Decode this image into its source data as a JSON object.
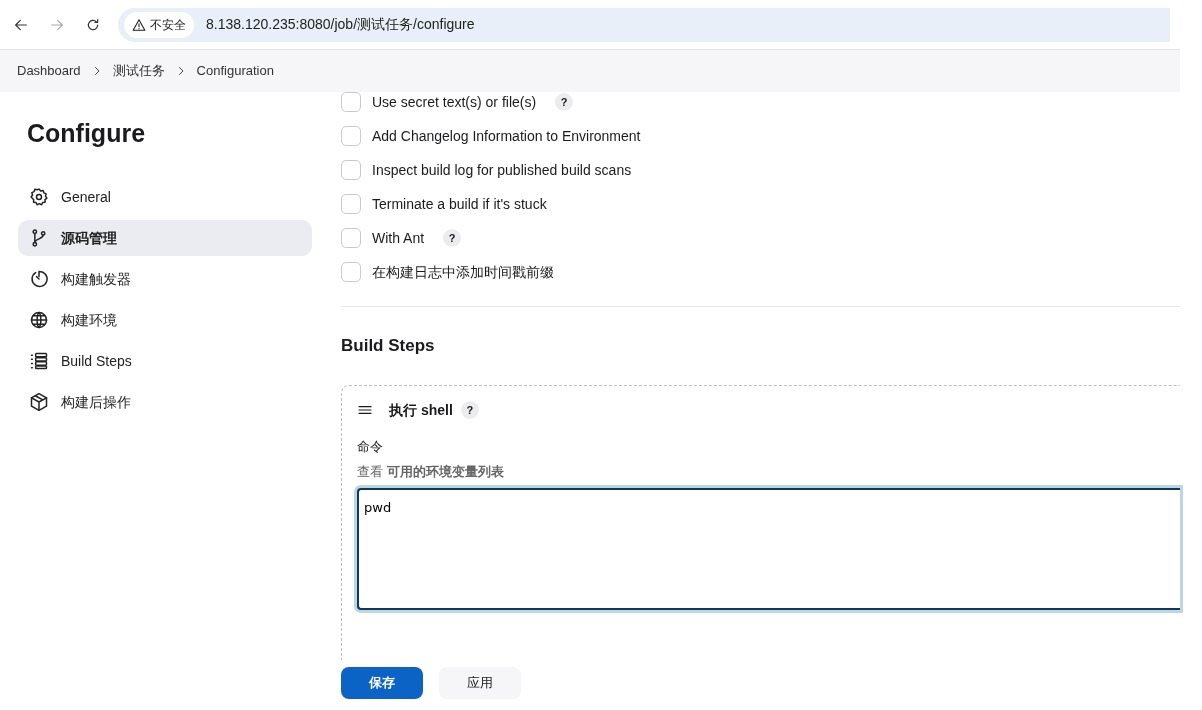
{
  "browser": {
    "nav": [
      {
        "kind": "back",
        "disabled": false
      },
      {
        "kind": "forward",
        "disabled": true
      },
      {
        "kind": "reload",
        "disabled": false
      }
    ],
    "security": "不安全",
    "url": "8.138.120.235:8080/job/测试任务/configure"
  },
  "breadcrumbs": [
    "Dashboard",
    "测试任务",
    "Configuration"
  ],
  "sidebar": {
    "title": "Configure",
    "items": [
      {
        "label": "General",
        "selected": false
      },
      {
        "label": "源码管理",
        "selected": true
      },
      {
        "label": "构建触发器",
        "selected": false
      },
      {
        "label": "构建环境",
        "selected": false
      },
      {
        "label": "Build Steps",
        "selected": false
      },
      {
        "label": "构建后操作",
        "selected": false
      }
    ]
  },
  "options": [
    {
      "label": "Use secret text(s) or file(s)",
      "checked": false,
      "help": "?"
    },
    {
      "label": "Add Changelog Information to Environment",
      "checked": false
    },
    {
      "label": "Inspect build log for published build scans",
      "checked": false
    },
    {
      "label": "Terminate a build if it's stuck",
      "checked": false
    },
    {
      "label": "With Ant",
      "checked": false,
      "help": "?"
    },
    {
      "label": "在构建日志中添加时间戳前缀",
      "checked": false
    }
  ],
  "build_steps": {
    "title": "Build Steps",
    "step": {
      "title": "执行 shell",
      "help": "?",
      "field_label": "命令",
      "hint_prefix": "查看",
      "hint_link": "可用的环境变量列表",
      "value": "pwd"
    }
  },
  "buttons": [
    {
      "label": "保存",
      "kind": "primary"
    },
    {
      "label": "应用",
      "kind": "secondary"
    }
  ]
}
